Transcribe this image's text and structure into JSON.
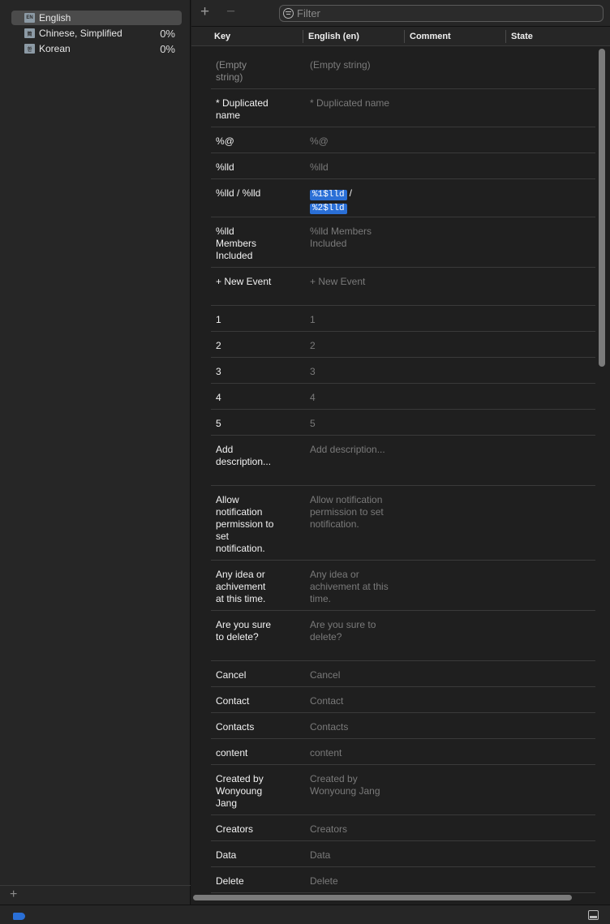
{
  "sidebar": {
    "languages": [
      {
        "label": "English",
        "percent": "",
        "code": "EN",
        "selected": true
      },
      {
        "label": "Chinese, Simplified",
        "percent": "0%",
        "code": "简",
        "selected": false
      },
      {
        "label": "Korean",
        "percent": "0%",
        "code": "한",
        "selected": false
      }
    ],
    "add_label": "+"
  },
  "toolbar": {
    "add_label": "+",
    "remove_label": "−",
    "filter_placeholder": "Filter"
  },
  "table": {
    "headers": {
      "key": "Key",
      "english": "English (en)",
      "comment": "Comment",
      "state": "State"
    },
    "rows": [
      {
        "key": "(Empty\nstring)",
        "value": "(Empty string)",
        "dim_key": true
      },
      {
        "key": "* Duplicated\nname",
        "value": "* Duplicated name"
      },
      {
        "key": "%@",
        "value": "%@"
      },
      {
        "key": "%lld",
        "value": "%lld"
      },
      {
        "key": "%lld / %lld",
        "value": "",
        "tokens": [
          "%1$lld",
          "/",
          "%2$lld"
        ]
      },
      {
        "key": "%lld\nMembers\nIncluded",
        "value": "%lld Members\nIncluded"
      },
      {
        "key": "+ New Event",
        "value": "+ New Event"
      },
      {
        "key": "1",
        "value": "1"
      },
      {
        "key": "2",
        "value": "2"
      },
      {
        "key": "3",
        "value": "3"
      },
      {
        "key": "4",
        "value": "4"
      },
      {
        "key": "5",
        "value": "5"
      },
      {
        "key": "Add\ndescription...",
        "value": "Add description..."
      },
      {
        "key": "Allow\nnotification\npermission to\nset\nnotification.",
        "value": "Allow notification\npermission to set\nnotification."
      },
      {
        "key": "Any idea or\nachivement\nat this time.",
        "value": "Any idea or\nachivement at this\ntime."
      },
      {
        "key": "Are you sure\nto delete?",
        "value": "Are you sure to\ndelete?"
      },
      {
        "key": "Cancel",
        "value": "Cancel"
      },
      {
        "key": "Contact",
        "value": "Contact"
      },
      {
        "key": "Contacts",
        "value": "Contacts"
      },
      {
        "key": "content",
        "value": "content"
      },
      {
        "key": "Created by\nWonyoung\nJang",
        "value": "Created by\nWonyoung Jang"
      },
      {
        "key": "Creators",
        "value": "Creators"
      },
      {
        "key": "Data",
        "value": "Data"
      },
      {
        "key": "Delete",
        "value": "Delete"
      }
    ]
  },
  "colors": {
    "accent": "#2a6fd6",
    "background": "#1f1f1f"
  }
}
